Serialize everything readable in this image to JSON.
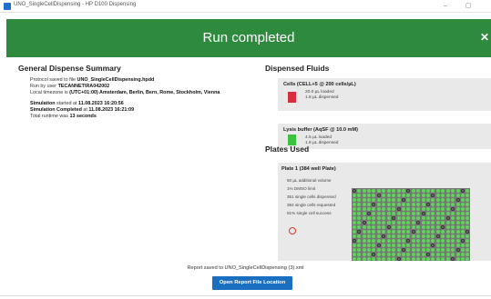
{
  "window": {
    "title": "UNO_SingleCellDispensing - HP D100 Dispensing"
  },
  "banner": {
    "title": "Run completed",
    "close_glyph": "✕"
  },
  "summary": {
    "heading": "General Dispense Summary",
    "line1_prefix": "Protocol saved to file ",
    "line1_value": "UNO_SingleCellDispensing.hpdd",
    "line2_prefix": "Run by user ",
    "line2_value": "TECANNET\\RA042002",
    "line3_prefix": "Local timezone is ",
    "line3_value": "(UTC+01:00) Amsterdam, Berlin, Bern, Rome, Stockholm, Vienna",
    "line4_label": "Simulation",
    "line4_text": " started at ",
    "line4_value": "11.08.2023 16:20:56",
    "line5_label": "Simulation Completed",
    "line5_text": " at ",
    "line5_value": "11.08.2023 16:21:09",
    "line6_prefix": "Total runtime was ",
    "line6_value": "13 seconds"
  },
  "fluids": {
    "heading": "Dispensed Fluids",
    "items": [
      {
        "name": "Cells (CELL+5 @ 200 cells/µL)",
        "color": "#d62e3a",
        "loaded": "20.0 µL loaded",
        "dispensed": "1.8 µL dispensed"
      },
      {
        "name": "Lysis buffer (AqSF @ 10.0 mM)",
        "color": "#3cc23f",
        "loaded": "4.5 µL loaded",
        "dispensed": "1.8 µL dispensed"
      }
    ]
  },
  "plates": {
    "heading": "Plates Used",
    "plate_title": "Plate 1 (384 well Plate)",
    "stats": [
      "50 µL additional volume",
      "1% DMSO limit",
      "351 single cells dispensed",
      "384 single cells requested",
      "91% single cell success"
    ],
    "well_colors": {
      "success": "#5fd35a",
      "fail": "#7a7a7a",
      "mark": "#333333"
    }
  },
  "report": {
    "saved_text": "Report saved to UNO_SingleCellDispensing (3).xml",
    "open_button": "Open Report File Location"
  },
  "icons": {
    "app": "app-icon",
    "warn": "warning-circle-icon",
    "close": "close-icon"
  }
}
